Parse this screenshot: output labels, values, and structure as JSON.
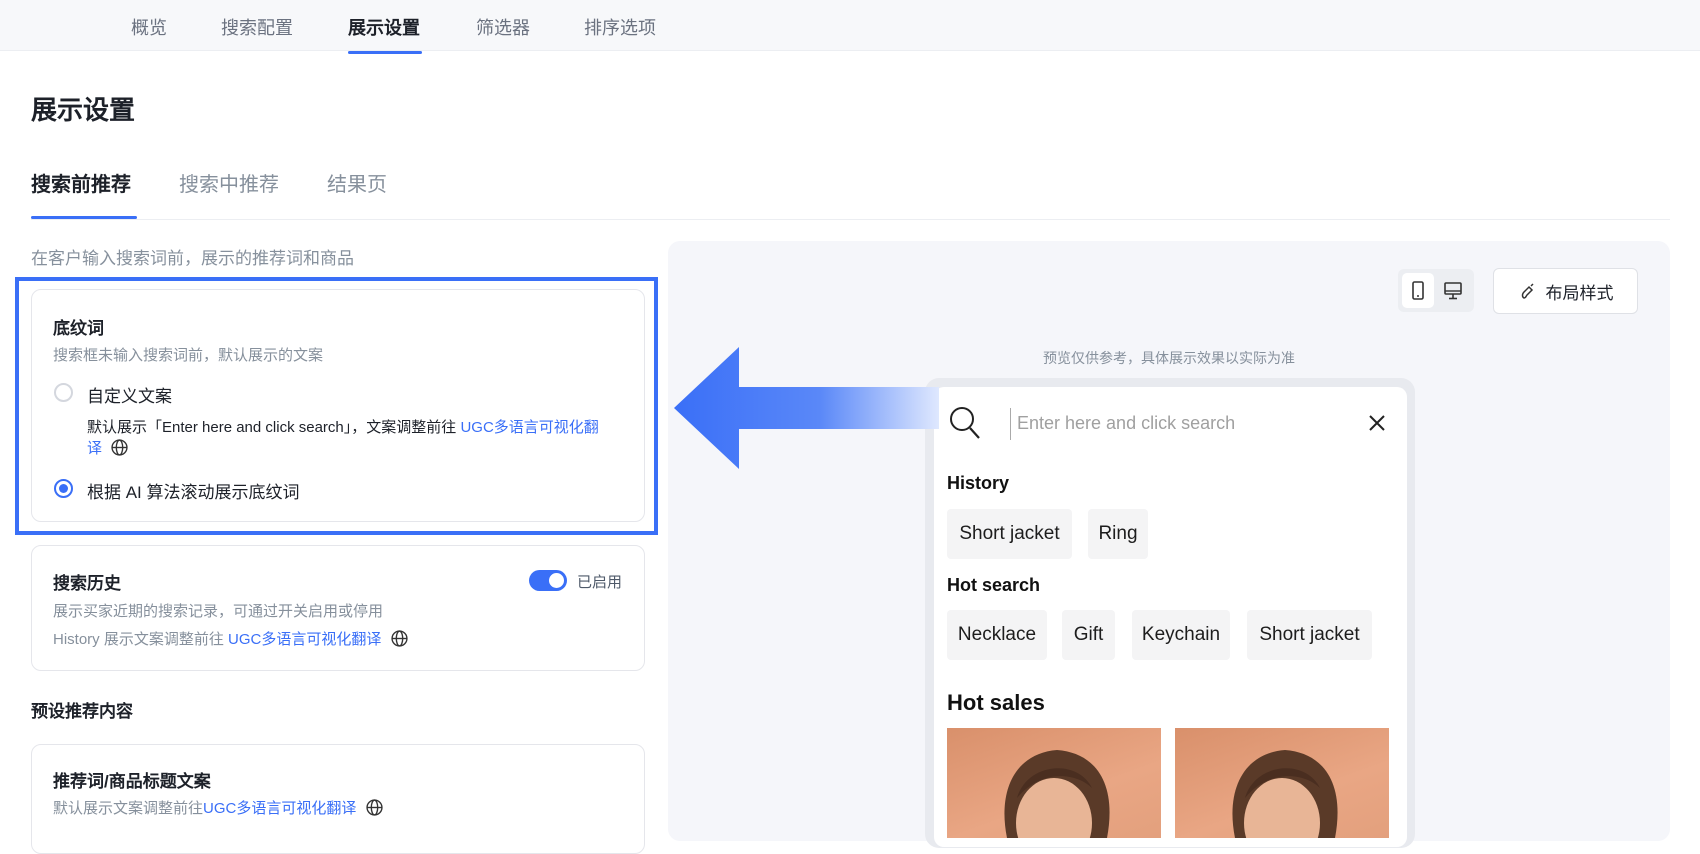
{
  "topnav": {
    "tabs": [
      "概览",
      "搜索配置",
      "展示设置",
      "筛选器",
      "排序选项"
    ],
    "active": "展示设置"
  },
  "page_title": "展示设置",
  "subtabs": [
    "搜索前推荐",
    "搜索中推荐",
    "结果页"
  ],
  "section_desc": "在客户输入搜索词前，展示的推荐词和商品",
  "placeholder_card": {
    "title": "底纹词",
    "desc": "搜索框未输入搜索词前，默认展示的文案",
    "option_custom": "自定义文案",
    "custom_hint": "默认展示「Enter here and click search」，文案调整前往",
    "custom_link": "UGC多语言可视化翻译",
    "option_ai": "根据 AI 算法滚动展示底纹词",
    "selected": "ai"
  },
  "history_card": {
    "title": "搜索历史",
    "desc": "展示买家近期的搜索记录，可通过开关启用或停用",
    "hint": "History 展示文案调整前往",
    "link": "UGC多语言可视化翻译",
    "toggle_on": true,
    "toggle_label": "已启用"
  },
  "preset_title": "预设推荐内容",
  "title_card": {
    "title": "推荐词/商品标题文案",
    "hint": "默认展示文案调整前往",
    "link": "UGC多语言可视化翻译"
  },
  "preview": {
    "layout_button": "布局样式",
    "note": "预览仅供参考，具体展示效果以实际为准",
    "search_placeholder": "Enter here and click search",
    "history_label": "History",
    "history_chips": [
      "Short jacket",
      "Ring"
    ],
    "hot_search_label": "Hot search",
    "hot_search_chips": [
      "Necklace",
      "Gift",
      "Keychain",
      "Short jacket"
    ],
    "hot_sales_label": "Hot sales"
  },
  "colors": {
    "accent": "#3a6ff7"
  }
}
